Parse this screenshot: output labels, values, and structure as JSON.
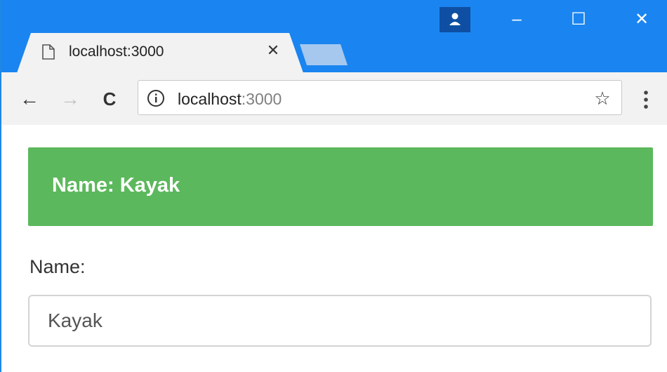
{
  "browser": {
    "tab": {
      "title": "localhost:3000",
      "close_glyph": "✕",
      "favicon": "page-icon"
    },
    "window_controls": {
      "minimize_glyph": "–",
      "maximize_glyph": "☐",
      "close_glyph": "✕",
      "profile_icon": "person-icon"
    },
    "toolbar": {
      "back_glyph": "←",
      "forward_glyph": "→",
      "reload_glyph": "C",
      "url_host": "localhost",
      "url_port": ":3000",
      "bookmark_glyph": "☆",
      "menu_icon": "three-dots-icon"
    },
    "colors": {
      "titlebar": "#1a85f0",
      "tab": "#f2f2f2",
      "profile_button": "#0e4fa3"
    }
  },
  "page": {
    "banner": {
      "text": "Name: Kayak",
      "color": "#5cb85c"
    },
    "form": {
      "label": "Name:",
      "value": "Kayak"
    }
  }
}
